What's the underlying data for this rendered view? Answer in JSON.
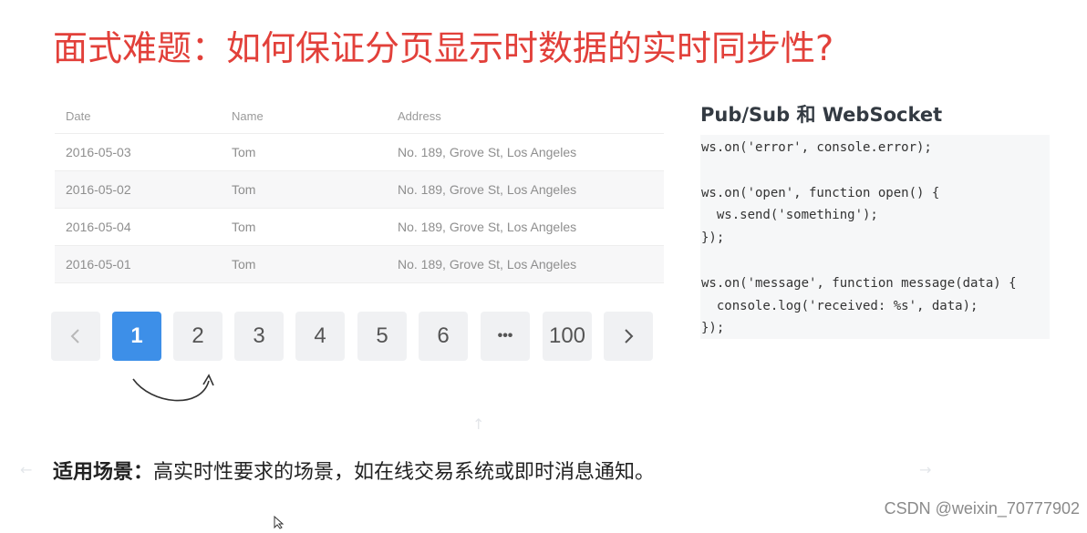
{
  "title": "面式难题：如何保证分页显示时数据的实时同步性?",
  "table": {
    "headers": [
      "Date",
      "Name",
      "Address"
    ],
    "rows": [
      [
        "2016-05-03",
        "Tom",
        "No. 189, Grove St, Los Angeles"
      ],
      [
        "2016-05-02",
        "Tom",
        "No. 189, Grove St, Los Angeles"
      ],
      [
        "2016-05-04",
        "Tom",
        "No. 189, Grove St, Los Angeles"
      ],
      [
        "2016-05-01",
        "Tom",
        "No. 189, Grove St, Los Angeles"
      ]
    ]
  },
  "pagination": {
    "pages": [
      "1",
      "2",
      "3",
      "4",
      "5",
      "6",
      "•••",
      "100"
    ],
    "active": "1"
  },
  "code": {
    "title": "Pub/Sub 和 WebSocket",
    "lines": [
      "ws.on('error', console.error);",
      "",
      "ws.on('open', function open() {",
      "  ws.send('something');",
      "});",
      "",
      "ws.on('message', function message(data) {",
      "  console.log('received: %s', data);",
      "});"
    ]
  },
  "scenario": {
    "label": "适用场景：",
    "text": "高实时性要求的场景，如在线交易系统或即时消息通知。"
  },
  "watermark": "CSDN @weixin_70777902",
  "colors": {
    "title": "#e2403a",
    "active_page": "#3d8fe8",
    "page_bg": "#f0f1f3",
    "code_bg": "#f6f7f8"
  },
  "icons": {
    "prev": "chevron-left-icon",
    "next": "chevron-right-icon",
    "curve": "curved-arrow-icon",
    "cursor": "mouse-cursor-icon"
  }
}
